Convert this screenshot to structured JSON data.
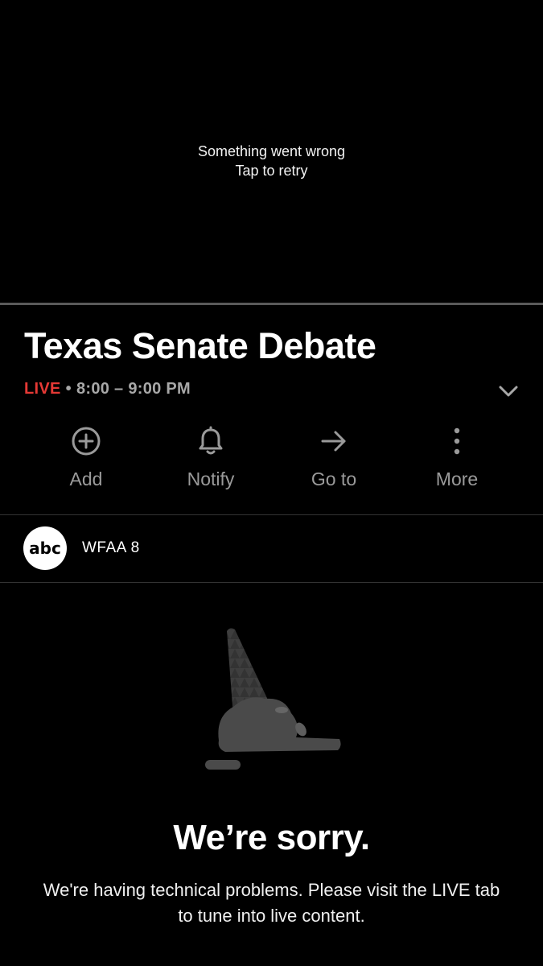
{
  "player": {
    "error_line1": "Something went wrong",
    "error_line2": "Tap to retry"
  },
  "program": {
    "title": "Texas Senate Debate",
    "live_label": "LIVE",
    "separator": "•",
    "time": "8:00 – 9:00 PM"
  },
  "actions": [
    {
      "label": "Add",
      "icon": "add-circle-icon"
    },
    {
      "label": "Notify",
      "icon": "bell-icon"
    },
    {
      "label": "Go to",
      "icon": "arrow-right-icon"
    },
    {
      "label": "More",
      "icon": "more-vertical-icon"
    }
  ],
  "channel": {
    "logo_text": "abc",
    "name": "WFAA 8"
  },
  "error": {
    "title": "We’re sorry.",
    "message": "We're having technical problems.  Please visit the LIVE tab to tune into live content."
  },
  "colors": {
    "live": "#e53935",
    "muted": "#9a9a9a",
    "background": "#000000"
  }
}
